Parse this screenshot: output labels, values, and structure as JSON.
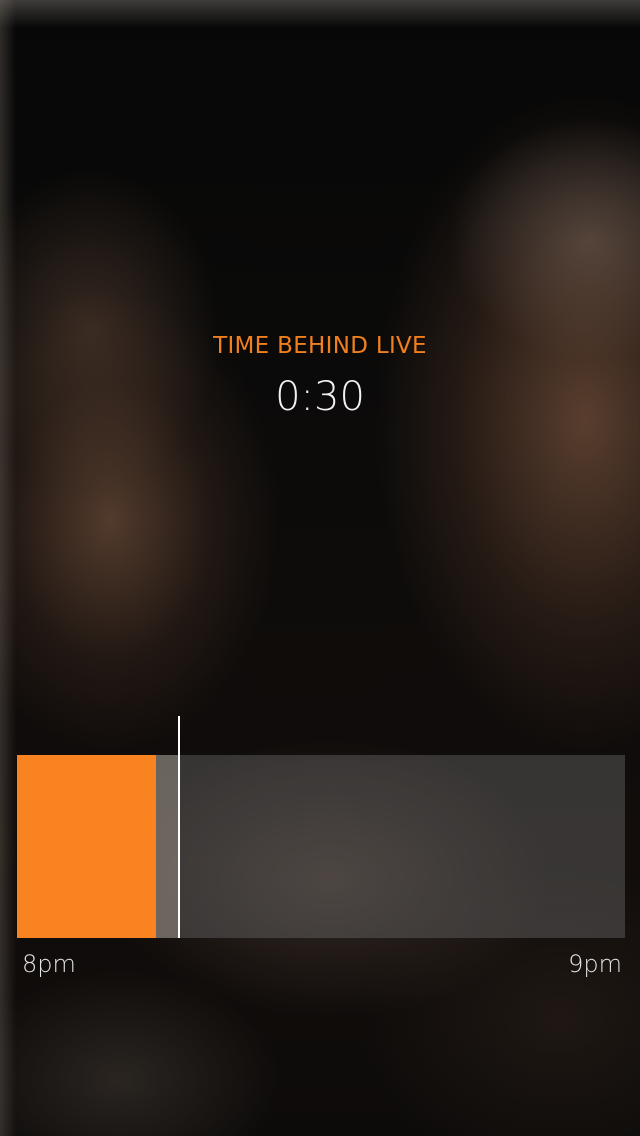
{
  "status": {
    "label": "TIME BEHIND LIVE",
    "time_behind": "0:30"
  },
  "timeline": {
    "start_label": "8pm",
    "end_label": "9pm",
    "played_fraction": 0.228,
    "buffered_fraction": 0.267,
    "playhead_fraction": 0.267,
    "colors": {
      "played": "#f98321",
      "label_accent": "#f07f1e",
      "playhead": "#ffffff"
    }
  }
}
